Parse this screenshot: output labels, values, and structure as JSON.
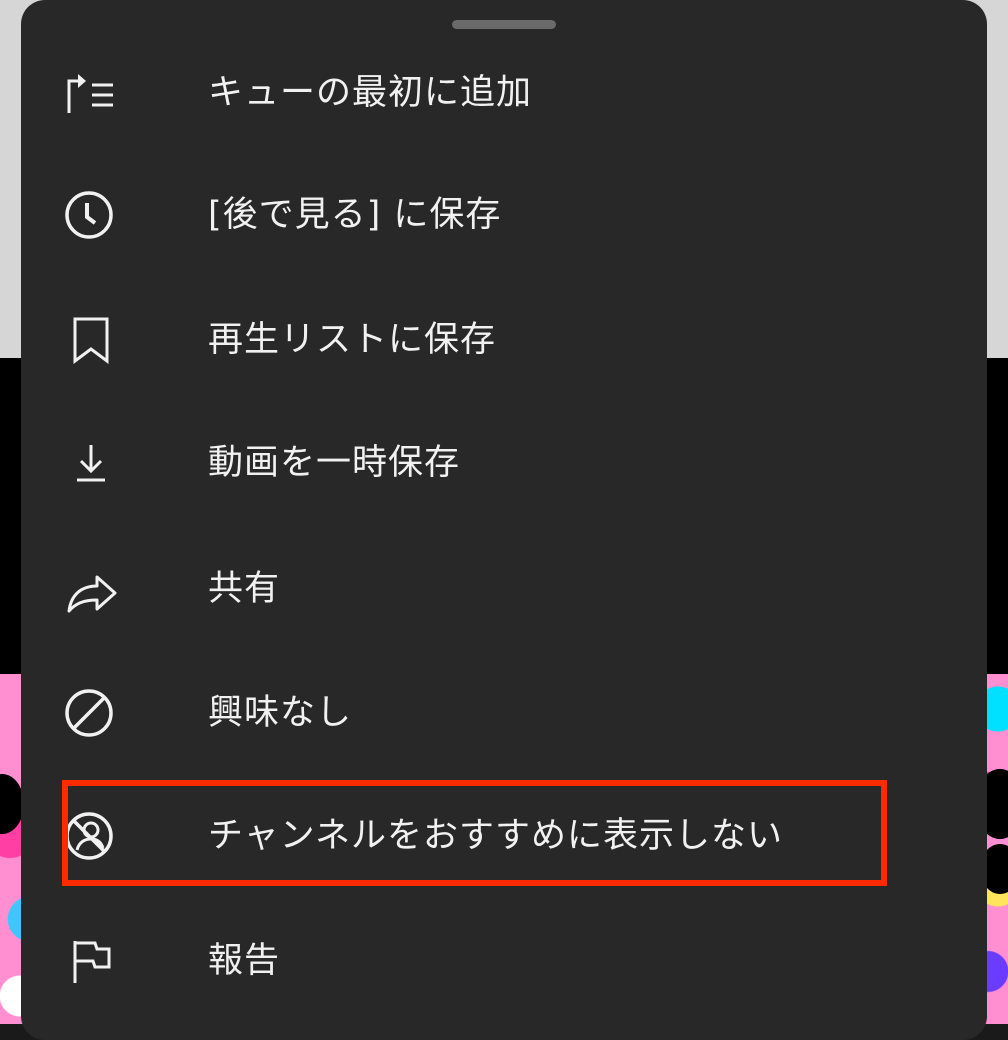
{
  "menu": {
    "items": [
      {
        "label": "キューの最初に追加",
        "icon": "play-next-queue-icon"
      },
      {
        "label": "[後で見る] に保存",
        "icon": "clock-icon"
      },
      {
        "label": "再生リストに保存",
        "icon": "bookmark-icon"
      },
      {
        "label": "動画を一時保存",
        "icon": "download-icon"
      },
      {
        "label": "共有",
        "icon": "share-icon"
      },
      {
        "label": "興味なし",
        "icon": "not-interested-icon"
      },
      {
        "label": "チャンネルをおすすめに表示しない",
        "icon": "block-channel-icon"
      },
      {
        "label": "報告",
        "icon": "flag-icon"
      }
    ],
    "highlighted_item_index": 6
  },
  "colors": {
    "sheet_background": "#282828",
    "text": "#f1f1f1",
    "highlight_border": "#ff2a00"
  }
}
